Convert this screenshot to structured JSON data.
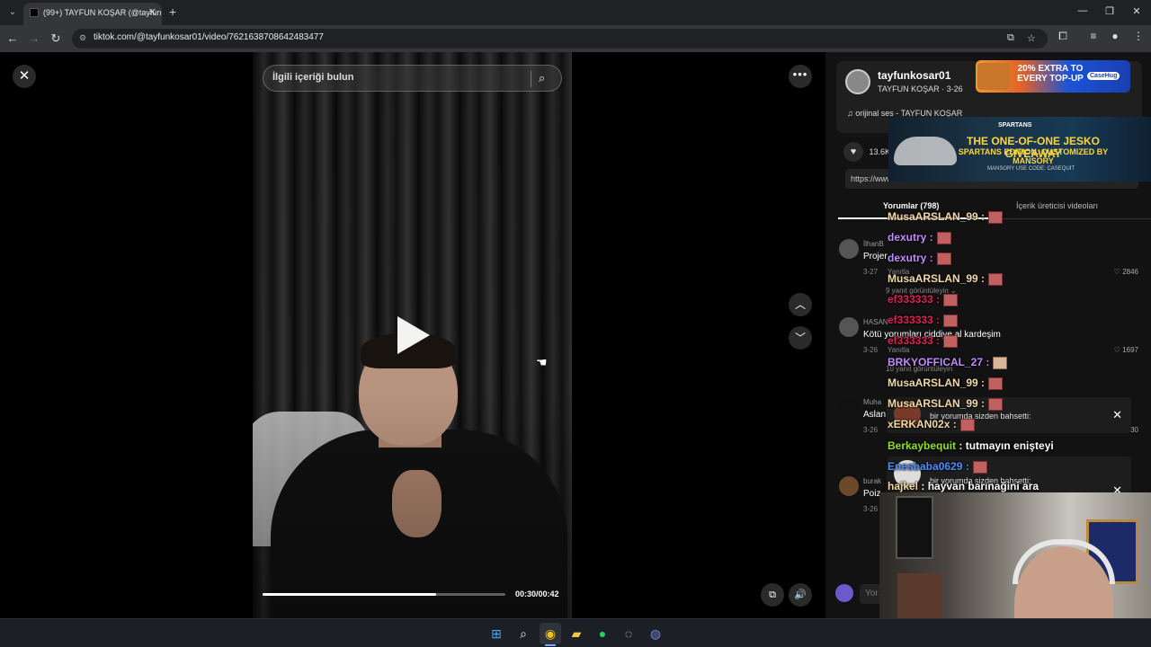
{
  "browser": {
    "tab_title": "(99+) TAYFUN KOŞAR (@tayfunk",
    "url": "tiktok.com/@tayfunkosar01/video/7621638708642483477"
  },
  "video": {
    "search_placeholder": "İlgili içeriği bulun",
    "time": "00:30/00:42",
    "progress": 0.714
  },
  "author": {
    "username": "tayfunkosar01",
    "display": "TAYFUN KOŞAR · 3-26",
    "music": "♫  orijinal ses - TAYFUN KOŞAR"
  },
  "stats": {
    "likes": "13.6K"
  },
  "share_url": "https://www...",
  "tabs": {
    "comments": "Yorumlar (798)",
    "creator_videos": "İçerik üreticisi videoları"
  },
  "comments": [
    {
      "user": "İlhanB",
      "text": "Projer",
      "date": "3-27",
      "reply": "Yanıtla",
      "likes": "2846",
      "more": "9 yanıt görüntüleyin ⌄"
    },
    {
      "user": "HASAN",
      "text": "Kötü yorumları ciddiye al kardeşim",
      "date": "3-26",
      "reply": "Yanıtla",
      "likes": "1697",
      "more": "10 yanıt görüntüleyin"
    },
    {
      "user": "Muha",
      "text": "Aslan",
      "date": "3-26",
      "reply": "",
      "likes": "30",
      "more": ""
    },
    {
      "user": "burak",
      "text": "Poiz",
      "date": "3-26",
      "reply": "",
      "likes": "",
      "more": ""
    }
  ],
  "comment_input_placeholder": "Yor",
  "ads": {
    "ad1_text": "20% EXTRA TO EVERY TOP-UP",
    "ad1_brand": "CaseHug",
    "ad2_brand": "SPARTANS",
    "ad2_line1": "THE ONE-OF-ONE JESKO GIVEAWAY",
    "ad2_line2": "SPARTANS EDITION. CUSTOMIZED BY MANSORY",
    "ad2_foot": "MANSORY   USE CODE: CASEQUIT"
  },
  "chat": [
    {
      "user": "MusaARSLAN_99 :",
      "msg": "",
      "color": "#f3d9a6"
    },
    {
      "user": "dexutry :",
      "msg": "",
      "color": "#c48bff"
    },
    {
      "user": "dexutry :",
      "msg": "",
      "color": "#c48bff"
    },
    {
      "user": "MusaARSLAN_99 :",
      "msg": "",
      "color": "#f3d9a6"
    },
    {
      "user": "ef333333 :",
      "msg": "",
      "color": "#e0224f"
    },
    {
      "user": "ef333333 :",
      "msg": "",
      "color": "#e0224f"
    },
    {
      "user": "ef333333 :",
      "msg": "",
      "color": "#e0224f"
    },
    {
      "user": "BRKYOFFICAL_27 :",
      "msg": "",
      "color": "#c48bff"
    },
    {
      "user": "MusaARSLAN_99 :",
      "msg": "",
      "color": "#f3d9a6"
    },
    {
      "user": "MusaARSLAN_99 :",
      "msg": "",
      "color": "#f3d9a6"
    },
    {
      "user": "xERKAN02x :",
      "msg": "",
      "color": "#f3d9a6"
    },
    {
      "user": "Berkaybequit",
      "msg": " : tutmayın enişteyi",
      "color": "#8ee02b"
    },
    {
      "user": "Enesbaba0629 :",
      "msg": "",
      "color": "#4a8fff"
    },
    {
      "user": "hajkel",
      "msg": " : hayvan barınağini ara",
      "color": "#f3d9a6"
    }
  ],
  "notifications": [
    {
      "text": "bir yorumda sizden bahsetti:"
    },
    {
      "text": "bir yorumda sizden bahsetti:"
    }
  ],
  "icons": {
    "close": "close-icon",
    "more": "more-icon",
    "search": "search-icon",
    "play": "play-icon",
    "up": "chevron-up-icon",
    "down": "chevron-down-icon"
  }
}
